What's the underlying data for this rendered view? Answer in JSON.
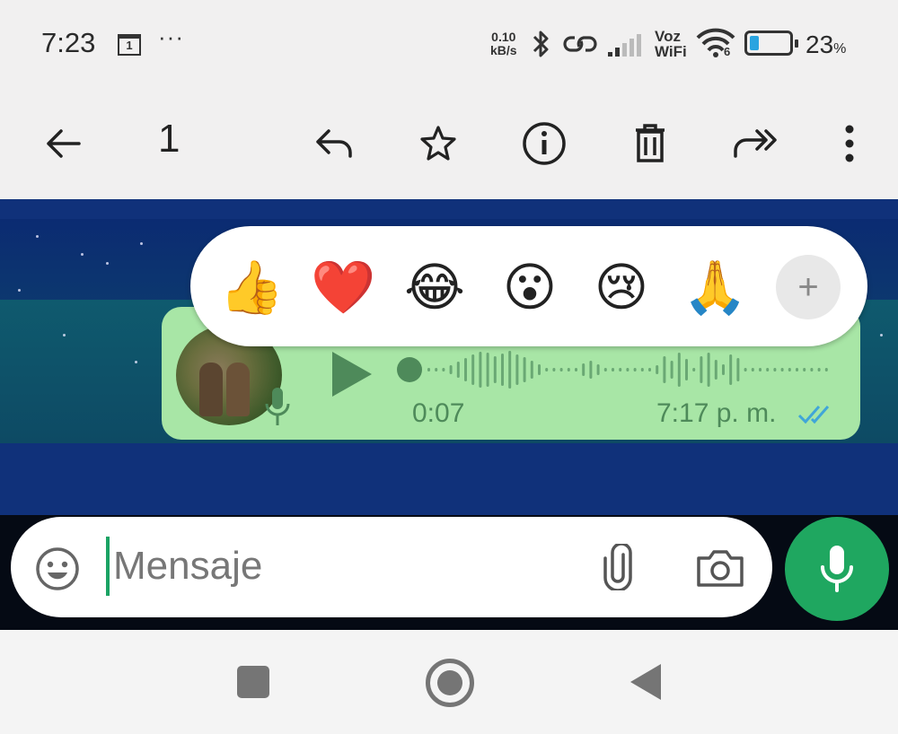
{
  "status_bar": {
    "time": "7:23",
    "calendar_day": "1",
    "more": "···",
    "net_speed_value": "0.10",
    "net_speed_unit": "kB/s",
    "voz": "Voz",
    "wifi_label": "WiFi",
    "wifi_number": "6",
    "battery_level": 0.23,
    "battery_percent": "23",
    "battery_percent_sign": "%"
  },
  "action_bar": {
    "selected_count": "1",
    "icons": [
      "back-arrow-icon",
      "reply-icon",
      "star-icon",
      "info-icon",
      "delete-icon",
      "forward-icon",
      "more-vert-icon"
    ]
  },
  "message": {
    "duration": "0:07",
    "time": "7:17 p. m.",
    "status": "read-double-tick",
    "accent_color": "#4e8a5a",
    "bubble_color": "#a8e6a6"
  },
  "reactions": {
    "emojis": [
      "👍",
      "❤️",
      "😂",
      "😮",
      "😢",
      "🙏"
    ],
    "more": "+"
  },
  "composer": {
    "placeholder": "Mensaje",
    "send_color": "#1fa760"
  },
  "nav_bar": {
    "buttons": [
      "recents-button",
      "home-button",
      "back-button"
    ]
  }
}
